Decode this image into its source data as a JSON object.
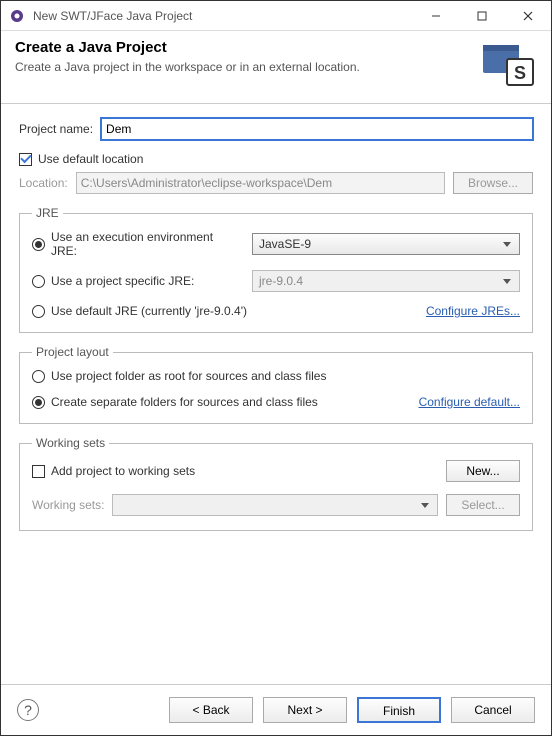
{
  "titlebar": {
    "title": "New SWT/JFace Java Project"
  },
  "header": {
    "heading": "Create a Java Project",
    "subheading": "Create a Java project in the workspace or in an external location."
  },
  "projectName": {
    "label": "Project name:",
    "value": "Dem"
  },
  "defaultLocation": {
    "checkboxLabel": "Use default location",
    "locationLabel": "Location:",
    "locationValue": "C:\\Users\\Administrator\\eclipse-workspace\\Dem",
    "browseLabel": "Browse..."
  },
  "jre": {
    "legend": "JRE",
    "opt1": "Use an execution environment JRE:",
    "opt1Value": "JavaSE-9",
    "opt2": "Use a project specific JRE:",
    "opt2Value": "jre-9.0.4",
    "opt3": "Use default JRE (currently 'jre-9.0.4')",
    "configureLink": "Configure JREs..."
  },
  "layout": {
    "legend": "Project layout",
    "opt1": "Use project folder as root for sources and class files",
    "opt2": "Create separate folders for sources and class files",
    "configureLink": "Configure default..."
  },
  "workingSets": {
    "legend": "Working sets",
    "addLabel": "Add project to working sets",
    "newLabel": "New...",
    "wsLabel": "Working sets:",
    "selectLabel": "Select..."
  },
  "footer": {
    "back": "< Back",
    "next": "Next >",
    "finish": "Finish",
    "cancel": "Cancel"
  }
}
